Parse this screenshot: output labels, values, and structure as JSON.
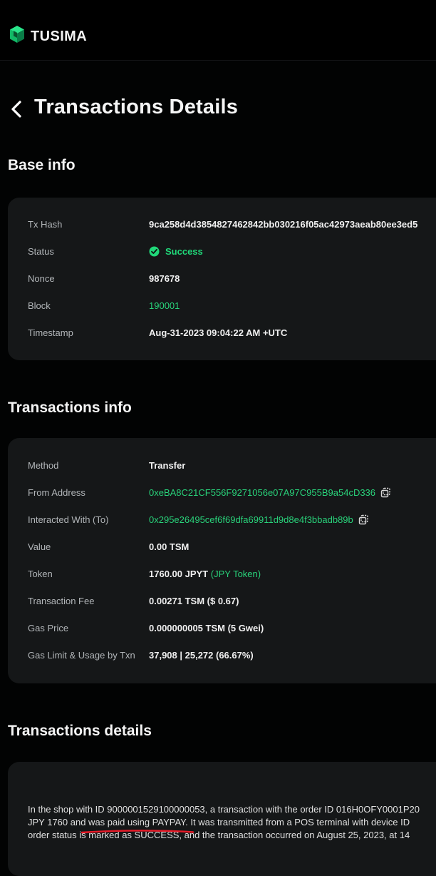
{
  "header": {
    "brand": "TUSIMA",
    "logo_color": "#22d67a"
  },
  "page": {
    "title": "Transactions Details",
    "back_icon": "chevron-left-icon"
  },
  "base_info": {
    "title": "Base info",
    "rows": [
      {
        "label": "Tx Hash",
        "value": "9ca258d4d3854827462842bb030216f05ac42973aeab80ee3ed5"
      },
      {
        "label": "Status",
        "value": "Success",
        "icon": "check-circle-icon"
      },
      {
        "label": "Nonce",
        "value": "987678"
      },
      {
        "label": "Block",
        "value": "190001"
      },
      {
        "label": "Timestamp",
        "value": "Aug-31-2023 09:04:22 AM +UTC"
      }
    ]
  },
  "transactions_info": {
    "title": "Transactions info",
    "rows": [
      {
        "label": "Method",
        "value": "Transfer"
      },
      {
        "label": "From Address",
        "value": "0xeBA8C21CF556F9271056e07A97C955B9a54cD336"
      },
      {
        "label": "Interacted With (To)",
        "value": "0x295e26495cef6f69dfa69911d9d8e4f3bbadb89b"
      },
      {
        "label": "Value",
        "value": "0.00 TSM"
      },
      {
        "label": "Token",
        "value": "1760.00 JPYT",
        "extra": "(JPY Token)"
      },
      {
        "label": "Transaction Fee",
        "value": "0.00271 TSM ($ 0.67)"
      },
      {
        "label": "Gas Price",
        "value": "0.000000005 TSM (5 Gwei)"
      },
      {
        "label": "Gas Limit & Usage by Txn",
        "value": "37,908 | 25,272 (66.67%)"
      }
    ]
  },
  "transactions_details": {
    "title": "Transactions details",
    "lines": [
      "In the shop with ID 9000001529100000053, a transaction with the order ID 016H0OFY0001P20",
      "JPY 1760 and was paid using PAYPAY. It was transmitted from a POS terminal with device ID",
      "order status is marked as SUCCESS, and the transaction occurred on August 25, 2023, at 14"
    ]
  },
  "colors": {
    "background": "#020303",
    "panel": "#151718",
    "accent": "#20d879",
    "annotation": "#e51b28"
  }
}
